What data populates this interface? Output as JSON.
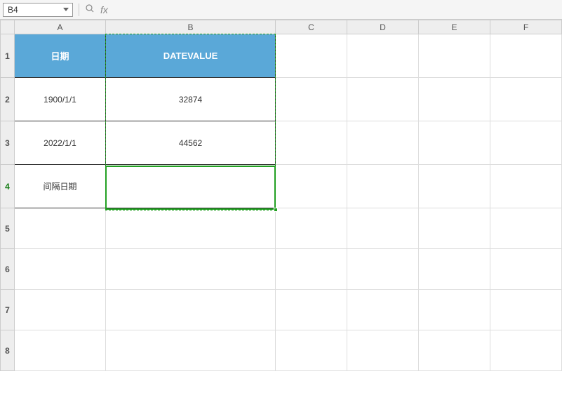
{
  "nameBox": {
    "value": "B4"
  },
  "formulaBar": {
    "fxLabel": "fx",
    "value": ""
  },
  "columns": [
    "A",
    "B",
    "C",
    "D",
    "E",
    "F"
  ],
  "rows": [
    "1",
    "2",
    "3",
    "4",
    "5",
    "6",
    "7",
    "8"
  ],
  "activeRow": "4",
  "headers": {
    "A1": "日期",
    "B1": "DATEVALUE"
  },
  "cells": {
    "A2": "1900/1/1",
    "B2": "32874",
    "A3": "2022/1/1",
    "B3": "44562",
    "A4": "间隔日期",
    "B4": ""
  },
  "chart_data": {
    "type": "table",
    "columns": [
      "日期",
      "DATEVALUE"
    ],
    "rows": [
      [
        "1900/1/1",
        32874
      ],
      [
        "2022/1/1",
        44562
      ],
      [
        "间隔日期",
        null
      ]
    ]
  }
}
